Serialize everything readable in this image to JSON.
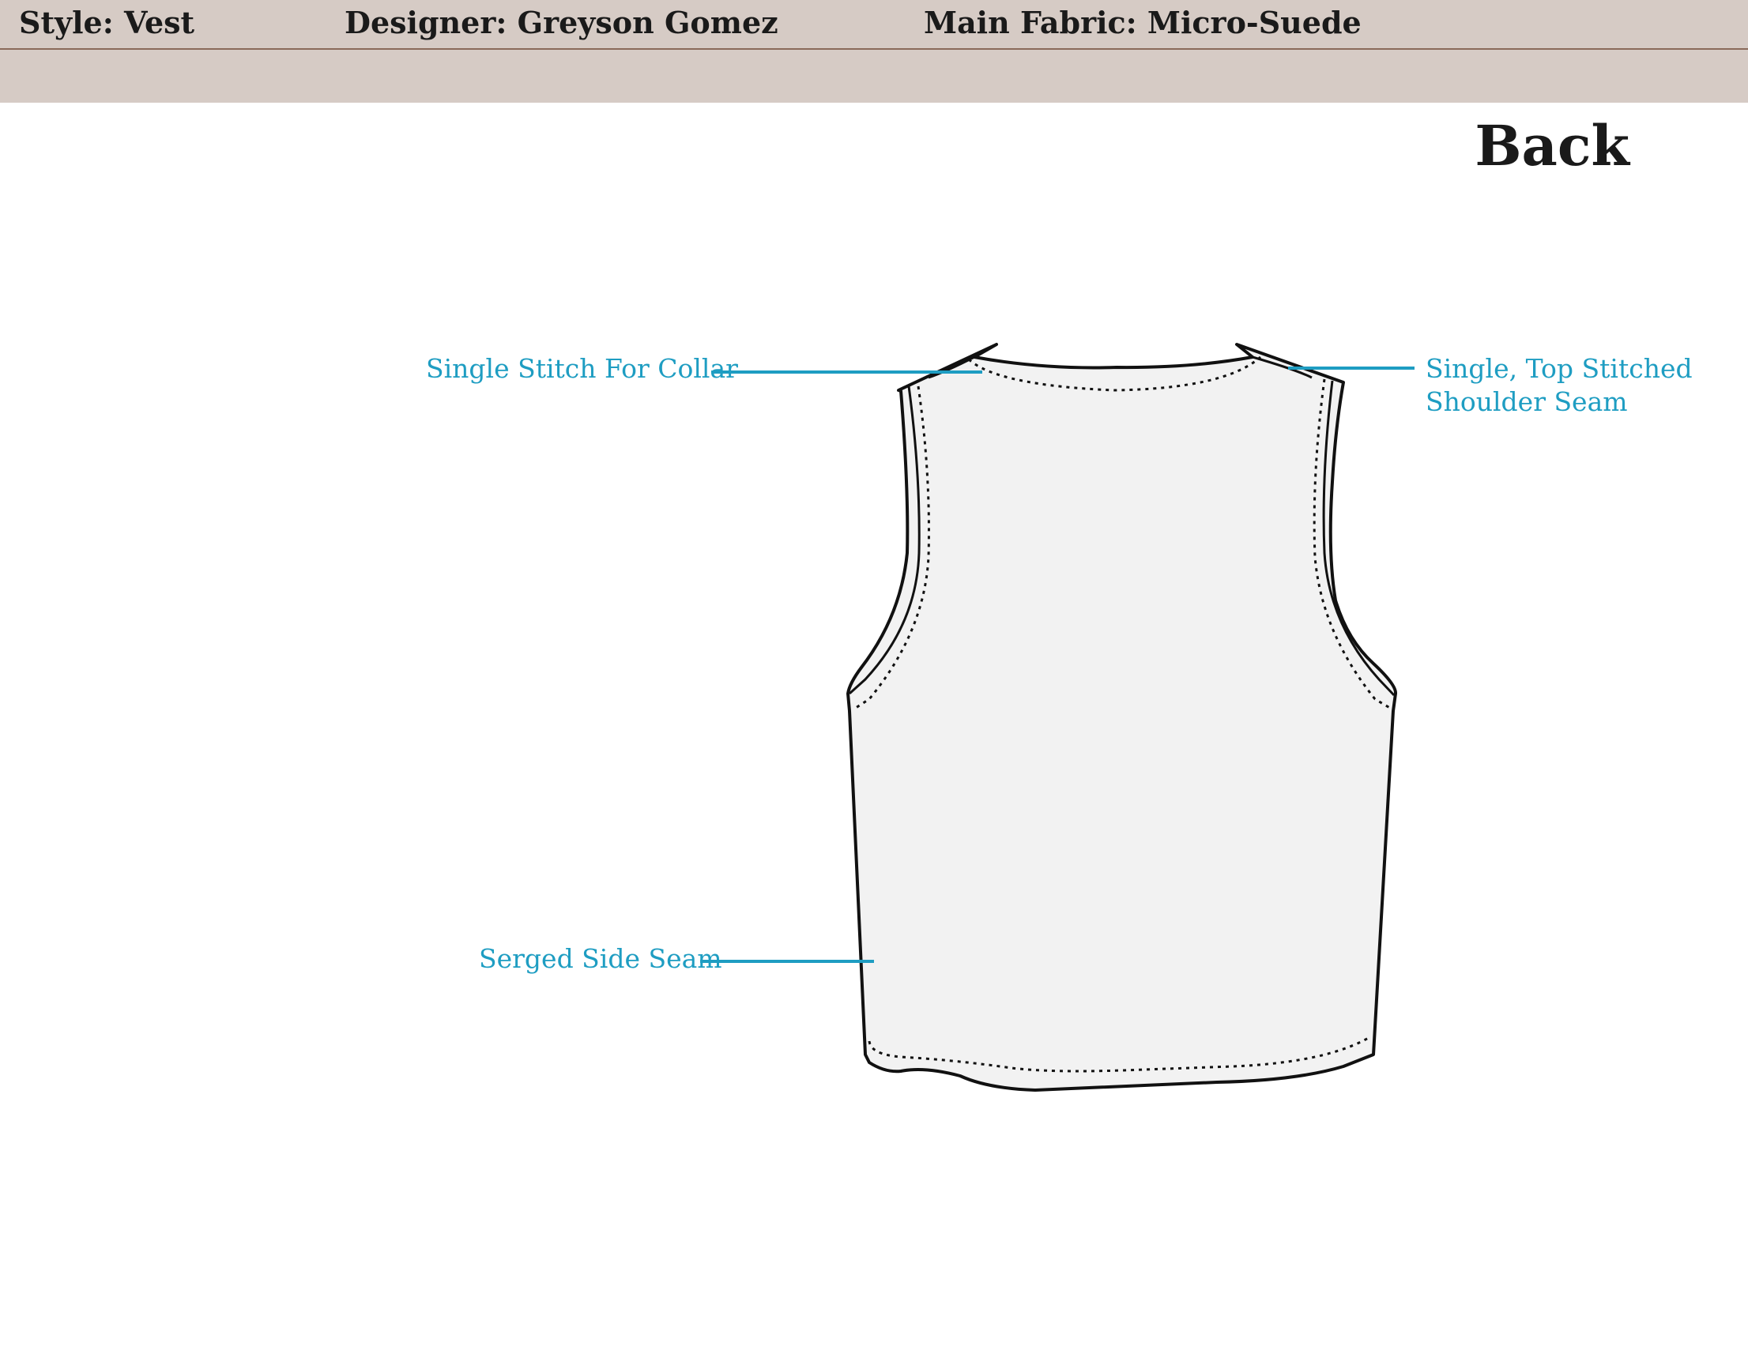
{
  "header": {
    "style": "Style: Vest",
    "designer": "Designer: Greyson Gomez",
    "fabric": "Main Fabric: Micro-Suede"
  },
  "view_title": "Back",
  "callouts": {
    "collar": "Single Stitch For Collar",
    "shoulder_line1": "Single, Top Stitched",
    "shoulder_line2": "Shoulder Seam",
    "side": "Serged Side Seam"
  },
  "colors": {
    "header_band": "#d6cbc5",
    "header_rule": "#8a6a5a",
    "callout": "#1e9dc2",
    "garment_fill": "#f2f2f2",
    "garment_outline": "#111111"
  }
}
